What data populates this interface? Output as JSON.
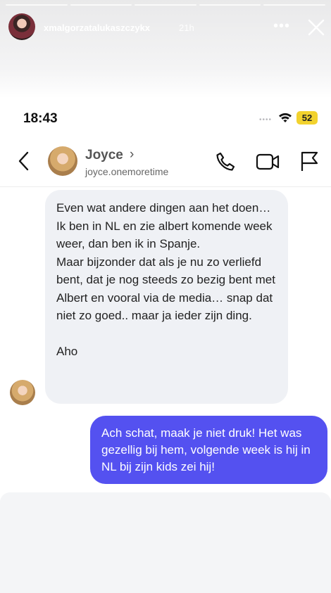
{
  "story": {
    "username": "xmalgorzatalukaszczykx",
    "time_ago": "21h",
    "more_icon": "more-horizontal-icon",
    "close_icon": "close-icon",
    "segments": 5
  },
  "status_bar": {
    "time": "18:43",
    "signal": "••••",
    "battery": "52",
    "battery_color": "#f2d22e"
  },
  "chat_header": {
    "name": "Joyce",
    "chevron": "›",
    "handle": "joyce.onemoretime",
    "icons": [
      "back-chevron-icon",
      "phone-icon",
      "video-camera-icon",
      "flag-icon"
    ]
  },
  "messages": {
    "incoming": {
      "text": "Even wat andere dingen aan het doen…\nIk ben in NL en zie albert komende week weer, dan ben ik in Spanje.\nMaar bijzonder dat als je nu zo verliefd bent, dat je nog steeds zo bezig bent met Albert en vooral via de media… snap dat niet zo goed.. maar ja ieder zijn ding.",
      "sign_off": "Aho"
    },
    "outgoing": {
      "text": "Ach schat, maak je niet druk! Het was gezellig bij hem, volgende week is hij in NL bij zijn kids zei hij!"
    }
  },
  "colors": {
    "incoming_bubble": "#eff1f5",
    "outgoing_bubble": "#5451f0"
  }
}
